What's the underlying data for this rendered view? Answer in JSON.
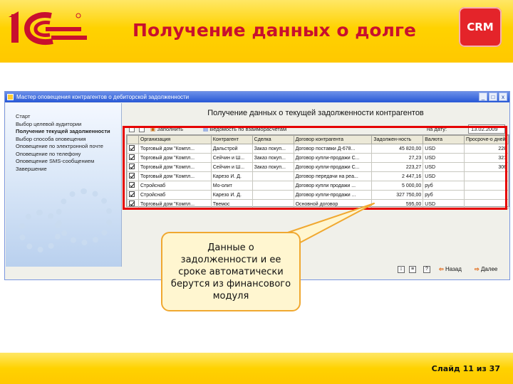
{
  "header": {
    "title": "Получение данных о долге",
    "crm_badge": "CRM",
    "logo_mark": "1С",
    "brand_color": "#c8102e"
  },
  "window": {
    "title": "Мастер оповещения контрагентов о дебиторской задолженности",
    "controls": [
      "_",
      "□",
      "x"
    ],
    "steps": [
      "Старт",
      "Выбор целевой аудитории",
      "Получение текущей задолженности",
      "Выбор способа оповещения",
      "Оповещение по электронной почте",
      "Оповещение по телефону",
      "Оповещение SMS-сообщением",
      "Завершение"
    ],
    "active_step_index": 2,
    "subtitle": "Получение данных о текущей задолженности контрагентов",
    "toolbar": {
      "fill_label": "Заполнить",
      "report_label": "Ведомость по взаиморасчетам",
      "date_label": "на дату:",
      "date_value": "13.02.2009"
    },
    "grid": {
      "columns": [
        "Организация",
        "Контрагент",
        "Сделка",
        "Договор контрагента",
        "Задолжен-ность",
        "Валюта",
        "Просроче-о дней"
      ],
      "rows": [
        {
          "org": "Торговый дом \"Компл...",
          "counterparty": "Дальстрой",
          "deal": "Заказ покуп...",
          "contract": "Договор поставки Д-678...",
          "debt": "45 820,00",
          "currency": "USD",
          "overdue": "228"
        },
        {
          "org": "Торговый дом \"Компл...",
          "counterparty": "Сейчин и Ш...",
          "deal": "Заказ покуп...",
          "contract": "Договор купли-продажи С...",
          "debt": "27,23",
          "currency": "USD",
          "overdue": "321"
        },
        {
          "org": "Торговый дом \"Компл...",
          "counterparty": "Сейчин и Ш...",
          "deal": "Заказ покуп...",
          "contract": "Договор купли-продажи С...",
          "debt": "223,27",
          "currency": "USD",
          "overdue": "306"
        },
        {
          "org": "Торговый дом \"Компл...",
          "counterparty": "Карезо И. Д.",
          "deal": "",
          "contract": "Договор передачи на реа...",
          "debt": "2 447,16",
          "currency": "USD",
          "overdue": ""
        },
        {
          "org": "Стройснаб",
          "counterparty": "Мо-олит",
          "deal": "",
          "contract": "Договор купли продажи ...",
          "debt": "5 000,00",
          "currency": "руб",
          "overdue": ""
        },
        {
          "org": "Стройснаб",
          "counterparty": "Карезо И. Д.",
          "deal": "",
          "contract": "Договор купли-продажи ...",
          "debt": "327 750,00",
          "currency": "руб",
          "overdue": ""
        },
        {
          "org": "Торговый дом \"Компл...",
          "counterparty": "Твемос",
          "deal": "",
          "contract": "Основной договор",
          "debt": "595,00",
          "currency": "USD",
          "overdue": ""
        }
      ]
    },
    "nav": {
      "back_label": "Назад",
      "next_label": "Далее",
      "help_label": "?"
    }
  },
  "callout": {
    "text": "Данные о задолженности и ее сроке автоматически берутся из финансового модуля"
  },
  "footer": {
    "slide_label": "Слайд 11 из 37"
  }
}
